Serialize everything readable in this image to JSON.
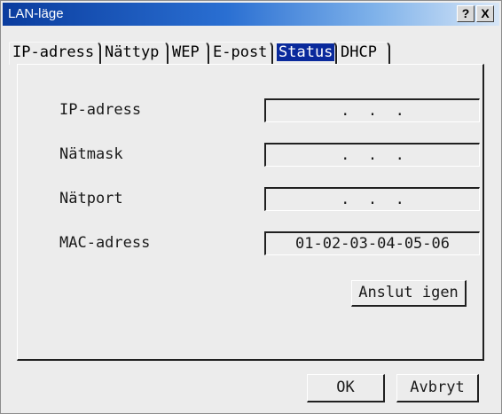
{
  "window": {
    "title": "LAN-läge",
    "help_label": "?",
    "close_label": "X"
  },
  "tabs": [
    {
      "label": "IP-adress",
      "active": false
    },
    {
      "label": "Nättyp",
      "active": false
    },
    {
      "label": "WEP",
      "active": false
    },
    {
      "label": "E-post",
      "active": false
    },
    {
      "label": "Status",
      "active": true
    },
    {
      "label": "DHCP",
      "active": false
    }
  ],
  "status": {
    "ip_label": "IP-adress",
    "ip_value": " .  .  . ",
    "mask_label": "Nätmask",
    "mask_value": " .  .  . ",
    "gateway_label": "Nätport",
    "gateway_value": " .  .  . ",
    "mac_label": "MAC-adress",
    "mac_value": "01-02-03-04-05-06",
    "connect_label": "Anslut igen"
  },
  "footer": {
    "ok_label": "OK",
    "cancel_label": "Avbryt"
  },
  "colors": {
    "title_start": "#0a3c9e",
    "title_end": "#d7e6f7",
    "active_tab": "#0a2a9c",
    "background": "#ececec"
  }
}
